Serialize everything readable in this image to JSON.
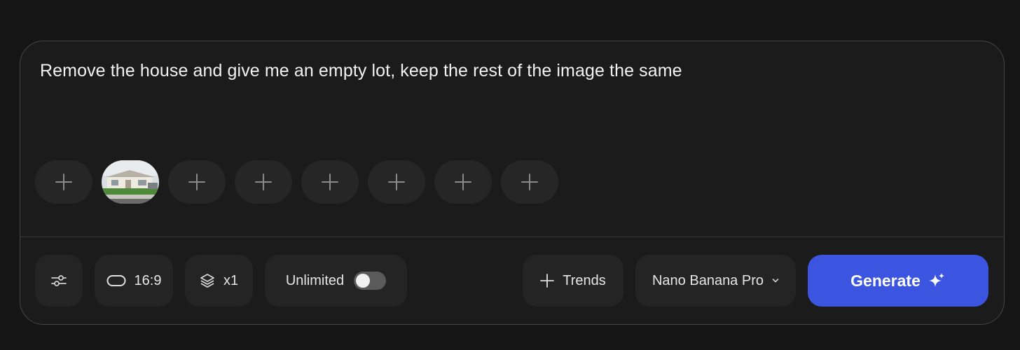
{
  "prompt": {
    "text": "Remove the house and give me an empty lot, keep the rest of the image the same"
  },
  "reference_slots": [
    {
      "type": "add",
      "icon": "plus-icon"
    },
    {
      "type": "image",
      "alt": "house photo thumbnail"
    },
    {
      "type": "add",
      "icon": "plus-icon"
    },
    {
      "type": "add",
      "icon": "plus-icon"
    },
    {
      "type": "add",
      "icon": "plus-icon"
    },
    {
      "type": "add",
      "icon": "plus-icon"
    },
    {
      "type": "add",
      "icon": "plus-icon"
    },
    {
      "type": "add",
      "icon": "plus-icon"
    }
  ],
  "toolbar": {
    "settings_icon": "sliders-icon",
    "aspect_ratio": {
      "icon": "aspect-ratio-icon",
      "label": "16:9"
    },
    "batch": {
      "icon": "layers-icon",
      "label": "x1"
    },
    "unlimited": {
      "label": "Unlimited",
      "enabled": false
    },
    "trends": {
      "icon": "plus-icon",
      "label": "Trends"
    },
    "model": {
      "label": "Nano Banana Pro",
      "icon": "chevron-down-icon"
    },
    "generate": {
      "label": "Generate",
      "icon": "sparkle-icon"
    }
  },
  "colors": {
    "background": "#151515",
    "panel": "#1b1b1b",
    "button": "#242424",
    "accent": "#3b55e0"
  }
}
